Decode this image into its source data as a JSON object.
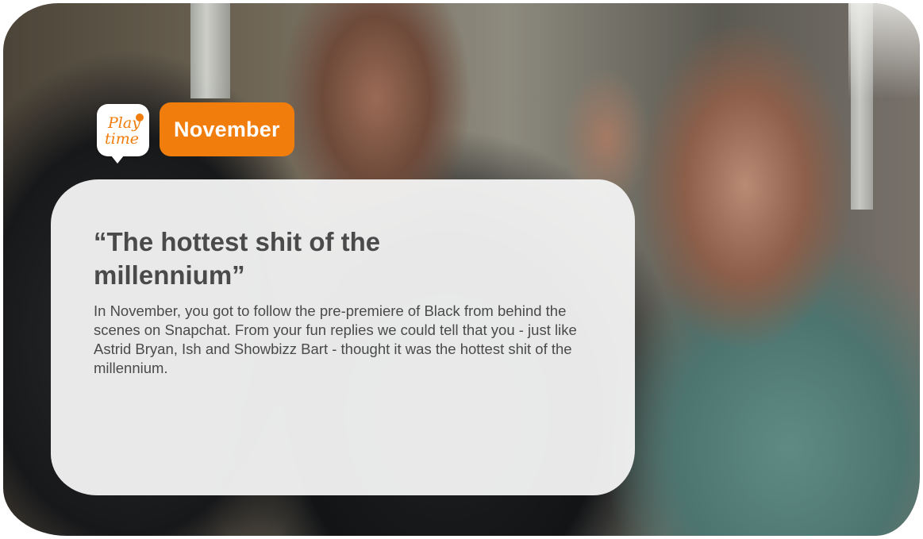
{
  "badge": {
    "logo_text_top": "Play",
    "logo_text_bottom": "time",
    "logo_color": "#f07d0c",
    "month": "November",
    "month_color": "#f07d0c"
  },
  "card": {
    "title": "“The hottest shit of the millennium”",
    "body": "In November, you got to follow the pre-premiere of Black from behind the scenes on Snapchat. From your fun replies we could tell that you - just like Astrid Bryan, Ish and Showbizz Bart - thought it was the hottest shit of the millennium."
  },
  "photo": {
    "description_icon": "photo-background"
  }
}
